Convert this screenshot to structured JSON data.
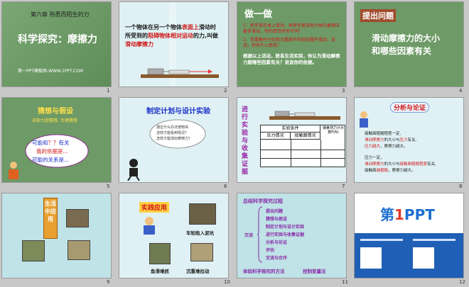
{
  "s1": {
    "chapter": "第六章  熟悉而陌生的力",
    "title": "科学探究：摩擦力",
    "footer": "第一PPT模板网-WWW.1PPT.COM",
    "num": "1"
  },
  "s2": {
    "l1": "一个物体在另一个物体",
    "l1b": "表面上",
    "l1c": "滑动时",
    "l2": "所受到的",
    "l2b": "阻碍物体相对运动",
    "l2c": "的力,叫做",
    "l3": "滑动摩擦力",
    "num": "2"
  },
  "s3": {
    "heading": "做一做",
    "p1": "1、把手放在桌上滑动，再使手更加用力地向桌面压着手滑动，你的感觉有何不同？",
    "p2": "2、手握着杆分别用力握紧杆和轻轻握杆滑动，说说，你有什么感受？",
    "p3": "根据以上活动，联系生活实际，你认为滑动摩擦力跟哪些因素有关？说说你的依据。",
    "num": "3"
  },
  "s4": {
    "heading": "提出问题",
    "q1": "滑动摩擦力的大小",
    "q2": "和哪些因素有关",
    "num": "4"
  },
  "s5": {
    "heading": "猜想与假设",
    "sub": "说依大胆猜想,  合理猜想",
    "b1": "可能和",
    "b1q": "？？",
    "b1e": "有关",
    "b2": "我的依据是...",
    "b3": "可能的关系是...",
    "num": "5"
  },
  "s6": {
    "heading": "制定计划与设计实验",
    "c1": "通过什么办法使物块",
    "c2": "怎样才能看到情况？",
    "c3": "怎样才能测出摩擦力？",
    "num": "6"
  },
  "s7": {
    "vert": "进行实验与收集证据",
    "h1": "实验条件",
    "h2": "压力情况",
    "h3": "接触面情况",
    "h4": "弹簧测力计示数F(N)",
    "num": "7"
  },
  "s8": {
    "heading": "分析与论证",
    "a1": "接触面粗糙程度一定,",
    "a2": "滑动摩擦力",
    "a2b": "的大小与",
    "a2c": "压力",
    "a2d": "有关,",
    "a3": "压力",
    "a3b": "越大",
    "a3c": "，摩擦力越大。",
    "b1": "压力一定，",
    "b2": "滑动摩擦力",
    "b2b": "的大小与",
    "b2c": "接触面粗糙程度",
    "b2d": "有关,",
    "b3": "接触面",
    "b3b": "越粗糙",
    "b3c": "，摩擦力越大。",
    "num": "8"
  },
  "s9": {
    "sign": "生活中应用",
    "num": "9"
  },
  "s10": {
    "heading": "实践应用",
    "l1": "车轮陷入泥坑",
    "l2": "鱼滑难抓",
    "l3": "沉重难拉动",
    "num": "10"
  },
  "s11": {
    "title": "总结科学探究过程",
    "steps": [
      "提出问题",
      "猜想与假设",
      "制定计划与设计实验",
      "进行实验与收集证据",
      "分析与论证",
      "评估",
      "交流与合作"
    ],
    "side": "交流",
    "foot1": "体验科学探究的方法",
    "foot2": "控制变量法",
    "num": "11"
  },
  "s12": {
    "logo_a": "第",
    "logo_b": "1",
    "logo_c": "PPT",
    "num": "12"
  }
}
